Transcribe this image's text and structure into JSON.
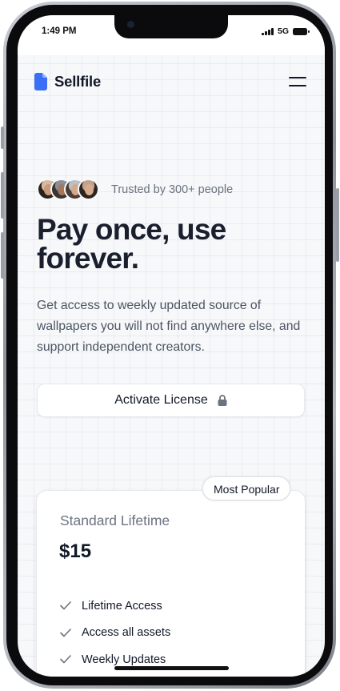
{
  "status_bar": {
    "time": "1:49 PM",
    "network": "5G",
    "signal_icon": "cellular-signal-icon",
    "battery_icon": "battery-icon"
  },
  "header": {
    "brand": "Sellfile",
    "logo_icon": "file-icon",
    "menu_icon": "hamburger-menu-icon"
  },
  "hero": {
    "trusted_text": "Trusted by 300+ people",
    "title_line1": "Pay once, use",
    "title_line2": "forever.",
    "description": "Get access to weekly updated source of wallpapers you will not find anywhere else, and support independent creators.",
    "cta_label": "Activate License",
    "cta_icon": "lock-icon"
  },
  "pricing": {
    "badge": "Most Popular",
    "plan_name": "Standard Lifetime",
    "price": "$15",
    "features": [
      "Lifetime Access",
      "Access all assets",
      "Weekly Updates"
    ],
    "feature_icon": "check-icon"
  },
  "colors": {
    "brand_blue": "#3b6ff5",
    "text_dark": "#111827",
    "text_muted": "#6b7280",
    "background": "#f7f8fa"
  }
}
